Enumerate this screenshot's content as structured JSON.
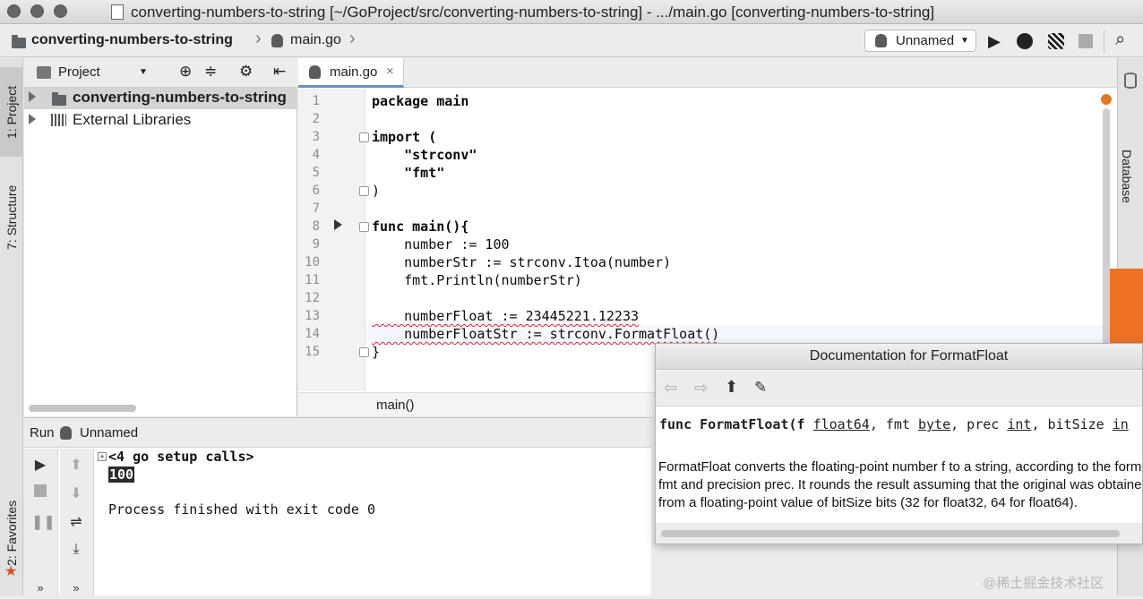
{
  "window": {
    "title": "converting-numbers-to-string [~/GoProject/src/converting-numbers-to-string] - .../main.go [converting-numbers-to-string]"
  },
  "navbar": {
    "crumb_project": "converting-numbers-to-string",
    "crumb_file": "main.go",
    "run_config": "Unnamed"
  },
  "left_stripe": {
    "project_tab": "1: Project",
    "structure_tab": "7: Structure",
    "favorites_tab": "2: Favorites"
  },
  "right_stripe": {
    "database_tab": "Database"
  },
  "project_panel": {
    "title": "Project",
    "items": [
      {
        "label": "converting-numbers-to-string"
      },
      {
        "label": "External Libraries"
      }
    ]
  },
  "editor": {
    "tab_label": "main.go",
    "breadcrumb": "main()",
    "lines": [
      {
        "n": "1",
        "text": "package main"
      },
      {
        "n": "2",
        "text": ""
      },
      {
        "n": "3",
        "text": "import ("
      },
      {
        "n": "4",
        "text": "    \"strconv\""
      },
      {
        "n": "5",
        "text": "    \"fmt\""
      },
      {
        "n": "6",
        "text": ")"
      },
      {
        "n": "7",
        "text": ""
      },
      {
        "n": "8",
        "text": "func main(){"
      },
      {
        "n": "9",
        "text": "    number := 100"
      },
      {
        "n": "10",
        "text": "    numberStr := strconv.Itoa(number)"
      },
      {
        "n": "11",
        "text": "    fmt.Println(numberStr)"
      },
      {
        "n": "12",
        "text": ""
      },
      {
        "n": "13",
        "text": "    numberFloat := 23445221.12233"
      },
      {
        "n": "14",
        "text": "    numberFloatStr := strconv.FormatFloat()"
      },
      {
        "n": "15",
        "text": "}"
      }
    ]
  },
  "run_panel": {
    "label": "Run",
    "config": "Unnamed",
    "output": [
      "<4 go setup calls>",
      "100",
      "",
      "Process finished with exit code 0"
    ]
  },
  "doc_popup": {
    "title": "Documentation for FormatFloat",
    "signature_prefix": "func FormatFloat(f ",
    "t1": "float64",
    "mid1": ", fmt ",
    "t2": "byte",
    "mid2": ", prec ",
    "t3": "int",
    "mid3": ", bitSize ",
    "t4": "in",
    "body": "FormatFloat converts the floating-point number f to a string, according to the format fmt and precision prec. It rounds the result assuming that the original was obtained from a floating-point value of bitSize bits (32 for float32, 64 for float64)."
  },
  "watermark": "@稀土掘金技术社区",
  "colors": {
    "accent_orange": "#ec7223",
    "selection_gray": "#d4d4d4",
    "tab_underline": "#6f8fbf"
  }
}
